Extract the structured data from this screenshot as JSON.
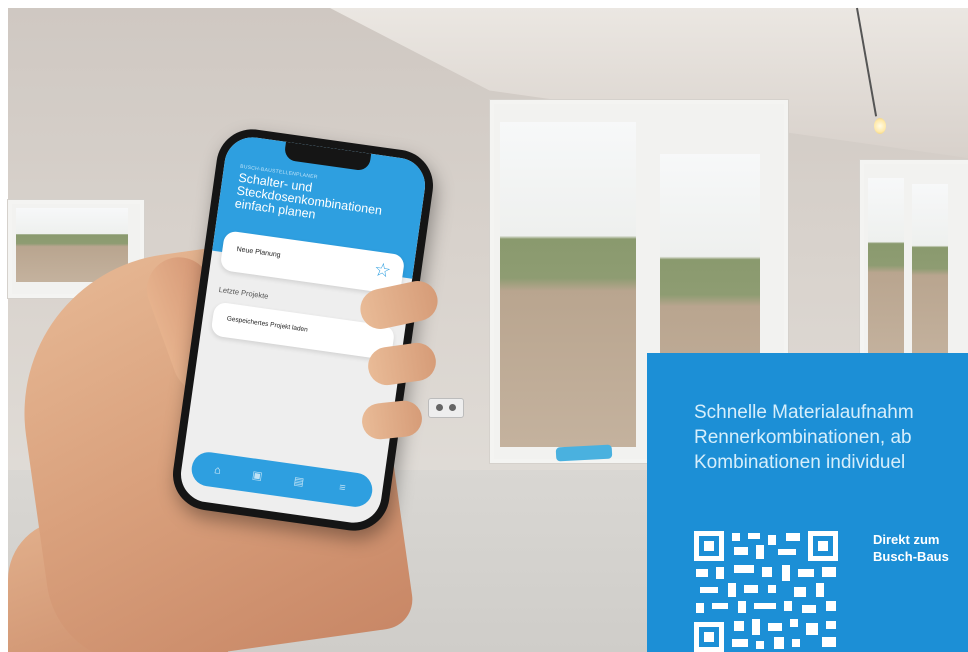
{
  "phone_app": {
    "header_kicker": "BUSCH-BAUSTELLENPLANER",
    "header_title": "Schalter- und Steckdosenkombinationen einfach planen",
    "new_planning_label": "Neue Planung",
    "recent_projects_label": "Letzte Projekte",
    "load_project_label": "Gespeichertes Projekt laden",
    "star_icon": "star-outline-icon",
    "tabs": [
      {
        "icon": "home-icon"
      },
      {
        "icon": "plan-icon"
      },
      {
        "icon": "list-icon"
      },
      {
        "icon": "menu-icon"
      }
    ],
    "accent_color": "#2e9fe0"
  },
  "promo": {
    "lines": [
      "Schnelle Materialaufnahm",
      "Rennerkombinationen, ab",
      "Kombinationen individuel"
    ],
    "link_lines": [
      "Direkt zum",
      "Busch-Baus"
    ],
    "qr_icon": "qr-code-icon",
    "background_color": "#1c8fd6"
  }
}
